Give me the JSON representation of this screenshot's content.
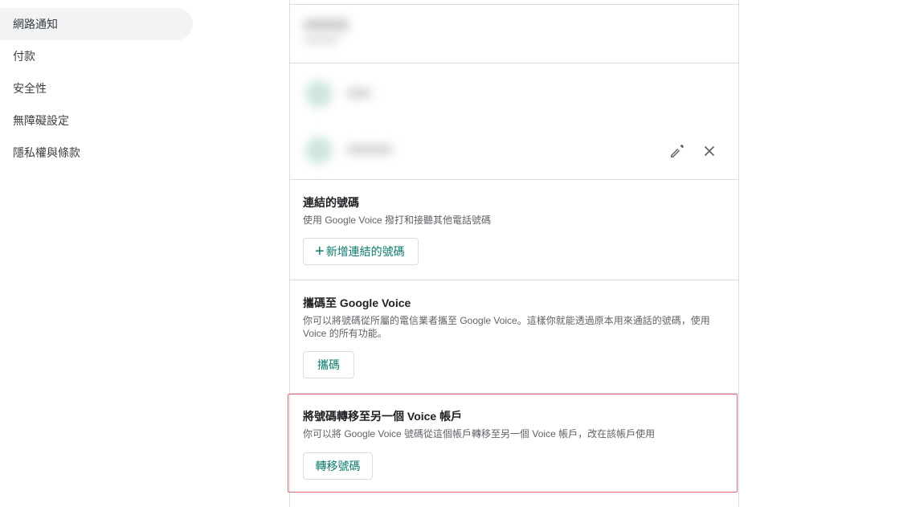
{
  "sidebar": {
    "items": [
      {
        "label": "網路通知",
        "active": true
      },
      {
        "label": "付款"
      },
      {
        "label": "安全性"
      },
      {
        "label": "無障礙設定"
      },
      {
        "label": "隱私權與條款"
      }
    ]
  },
  "device_actions": {
    "edit_icon": "pencil-icon",
    "remove_icon": "close-icon"
  },
  "linked_numbers": {
    "title": "連結的號碼",
    "description": "使用 Google Voice 撥打和接聽其他電話號碼",
    "add_button": "新增連結的號碼",
    "add_icon": "+"
  },
  "port_in": {
    "title": "攜碼至 Google Voice",
    "description": "你可以將號碼從所屬的電信業者攜至 Google Voice。這樣你就能透過原本用來通話的號碼，使用 Voice 的所有功能。",
    "button": "攜碼"
  },
  "transfer": {
    "title": "將號碼轉移至另一個 Voice 帳戶",
    "description": "你可以將 Google Voice 號碼從這個帳戶轉移至另一個 Voice 帳戶，改在該帳戶使用",
    "button": "轉移號碼"
  },
  "colors": {
    "accent": "#0b7a6e",
    "highlight": "#e06d73",
    "border": "#dadce0"
  }
}
